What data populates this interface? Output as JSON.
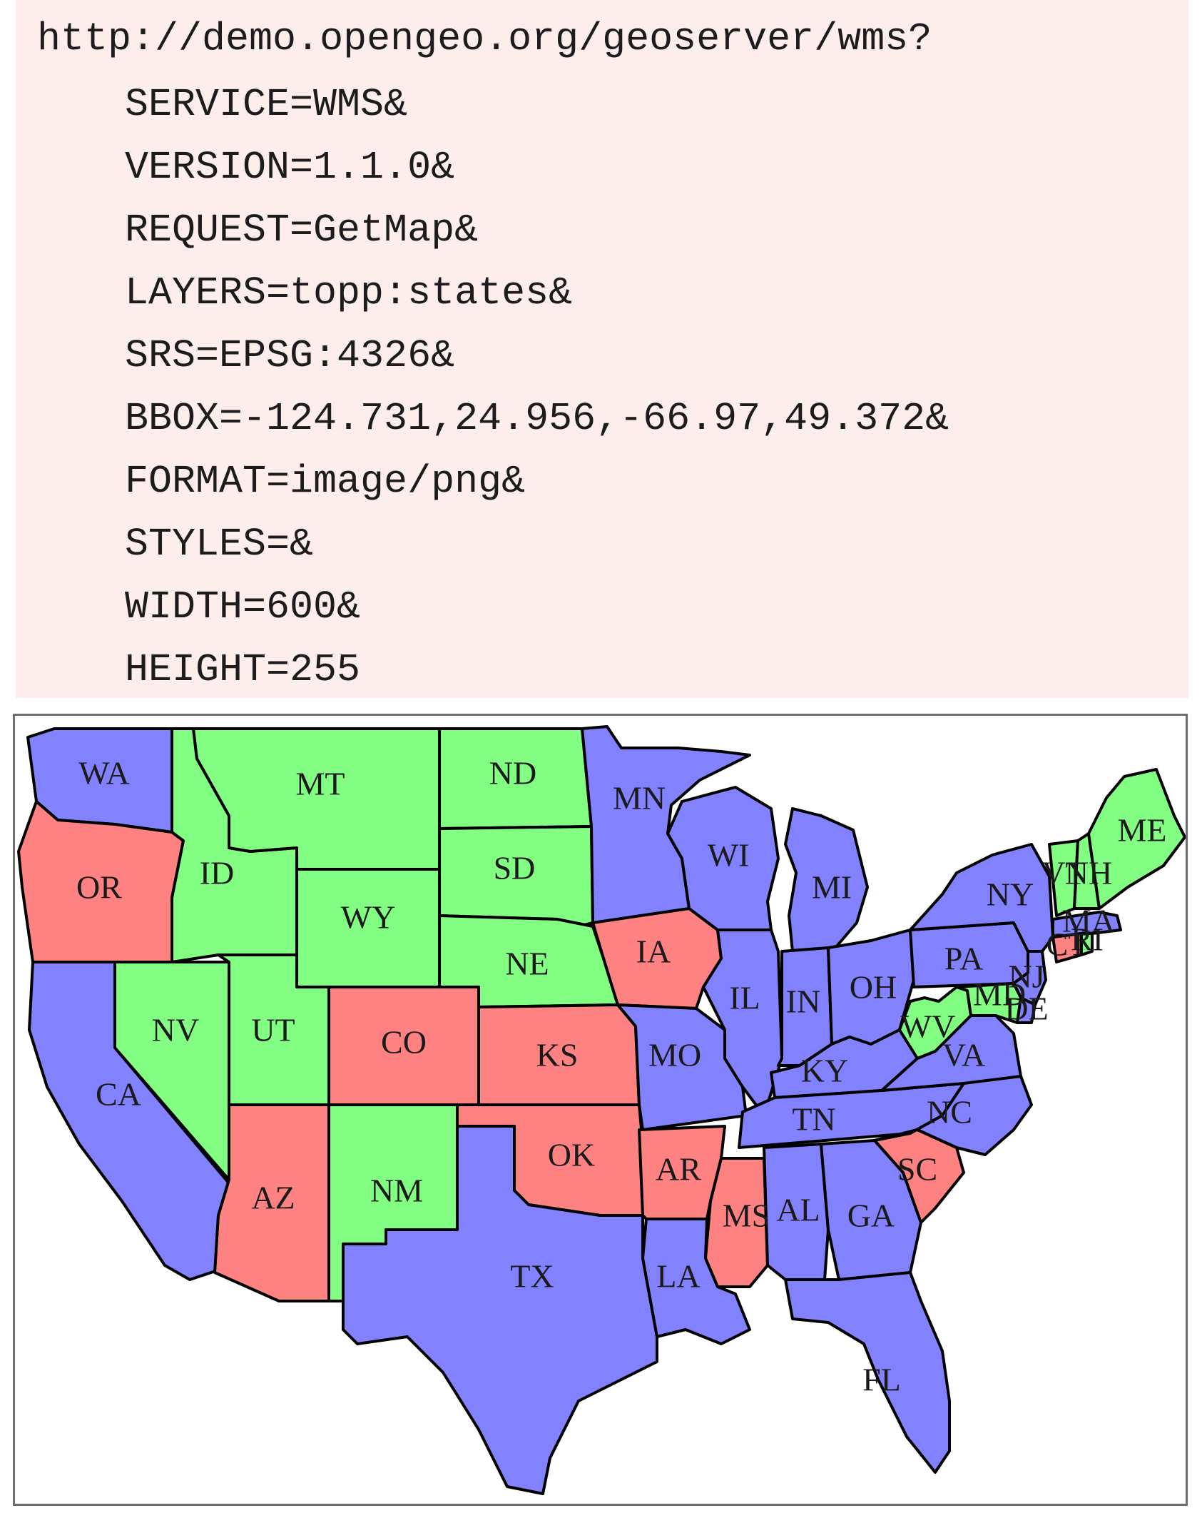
{
  "request": {
    "url": "http://demo.opengeo.org/geoserver/wms?",
    "params": [
      "SERVICE=WMS&",
      "VERSION=1.1.0&",
      "REQUEST=GetMap&",
      "LAYERS=topp:states&",
      "SRS=EPSG:4326&",
      "BBOX=-124.731,24.956,-66.97,49.372&",
      "FORMAT=image/png&",
      "STYLES=&",
      "WIDTH=600&",
      "HEIGHT=255"
    ]
  },
  "map": {
    "colors": {
      "blue": "#8282ff",
      "green": "#82ff82",
      "red": "#ff8282"
    },
    "states": [
      {
        "id": "WA",
        "label": "WA",
        "fill": "blue"
      },
      {
        "id": "OR",
        "label": "OR",
        "fill": "red"
      },
      {
        "id": "CA",
        "label": "CA",
        "fill": "blue"
      },
      {
        "id": "ID",
        "label": "ID",
        "fill": "green"
      },
      {
        "id": "MT",
        "label": "MT",
        "fill": "green"
      },
      {
        "id": "ND",
        "label": "ND",
        "fill": "green"
      },
      {
        "id": "SD",
        "label": "SD",
        "fill": "green"
      },
      {
        "id": "WY",
        "label": "WY",
        "fill": "green"
      },
      {
        "id": "NE",
        "label": "NE",
        "fill": "green"
      },
      {
        "id": "NV",
        "label": "NV",
        "fill": "green"
      },
      {
        "id": "UT",
        "label": "UT",
        "fill": "green"
      },
      {
        "id": "CO",
        "label": "CO",
        "fill": "red"
      },
      {
        "id": "KS",
        "label": "KS",
        "fill": "red"
      },
      {
        "id": "AZ",
        "label": "AZ",
        "fill": "red"
      },
      {
        "id": "NM",
        "label": "NM",
        "fill": "green"
      },
      {
        "id": "OK",
        "label": "OK",
        "fill": "red"
      },
      {
        "id": "TX",
        "label": "TX",
        "fill": "blue"
      },
      {
        "id": "MN",
        "label": "MN",
        "fill": "blue"
      },
      {
        "id": "IA",
        "label": "IA",
        "fill": "red"
      },
      {
        "id": "MO",
        "label": "MO",
        "fill": "blue"
      },
      {
        "id": "AR",
        "label": "AR",
        "fill": "red"
      },
      {
        "id": "LA",
        "label": "LA",
        "fill": "blue"
      },
      {
        "id": "WI",
        "label": "WI",
        "fill": "blue"
      },
      {
        "id": "IL",
        "label": "IL",
        "fill": "blue"
      },
      {
        "id": "MI",
        "label": "MI",
        "fill": "blue"
      },
      {
        "id": "IN",
        "label": "IN",
        "fill": "blue"
      },
      {
        "id": "OH",
        "label": "OH",
        "fill": "blue"
      },
      {
        "id": "KY",
        "label": "KY",
        "fill": "blue"
      },
      {
        "id": "TN",
        "label": "TN",
        "fill": "blue"
      },
      {
        "id": "MS",
        "label": "MS",
        "fill": "red"
      },
      {
        "id": "AL",
        "label": "AL",
        "fill": "blue"
      },
      {
        "id": "GA",
        "label": "GA",
        "fill": "blue"
      },
      {
        "id": "FL",
        "label": "FL",
        "fill": "blue"
      },
      {
        "id": "SC",
        "label": "SC",
        "fill": "red"
      },
      {
        "id": "NC",
        "label": "NC",
        "fill": "blue"
      },
      {
        "id": "VA",
        "label": "VA",
        "fill": "blue"
      },
      {
        "id": "WV",
        "label": "WV",
        "fill": "green"
      },
      {
        "id": "PA",
        "label": "PA",
        "fill": "blue"
      },
      {
        "id": "NY",
        "label": "NY",
        "fill": "blue"
      },
      {
        "id": "NJ",
        "label": "NJ",
        "fill": "blue"
      },
      {
        "id": "MD",
        "label": "MD",
        "fill": "green"
      },
      {
        "id": "DE",
        "label": "DE",
        "fill": "blue"
      },
      {
        "id": "CT",
        "label": "CT",
        "fill": "red"
      },
      {
        "id": "RI",
        "label": "RI",
        "fill": "green"
      },
      {
        "id": "MA",
        "label": "MA",
        "fill": "blue"
      },
      {
        "id": "VT",
        "label": "VT",
        "fill": "green"
      },
      {
        "id": "NH",
        "label": "NH",
        "fill": "green"
      },
      {
        "id": "ME",
        "label": "ME",
        "fill": "green"
      }
    ]
  }
}
